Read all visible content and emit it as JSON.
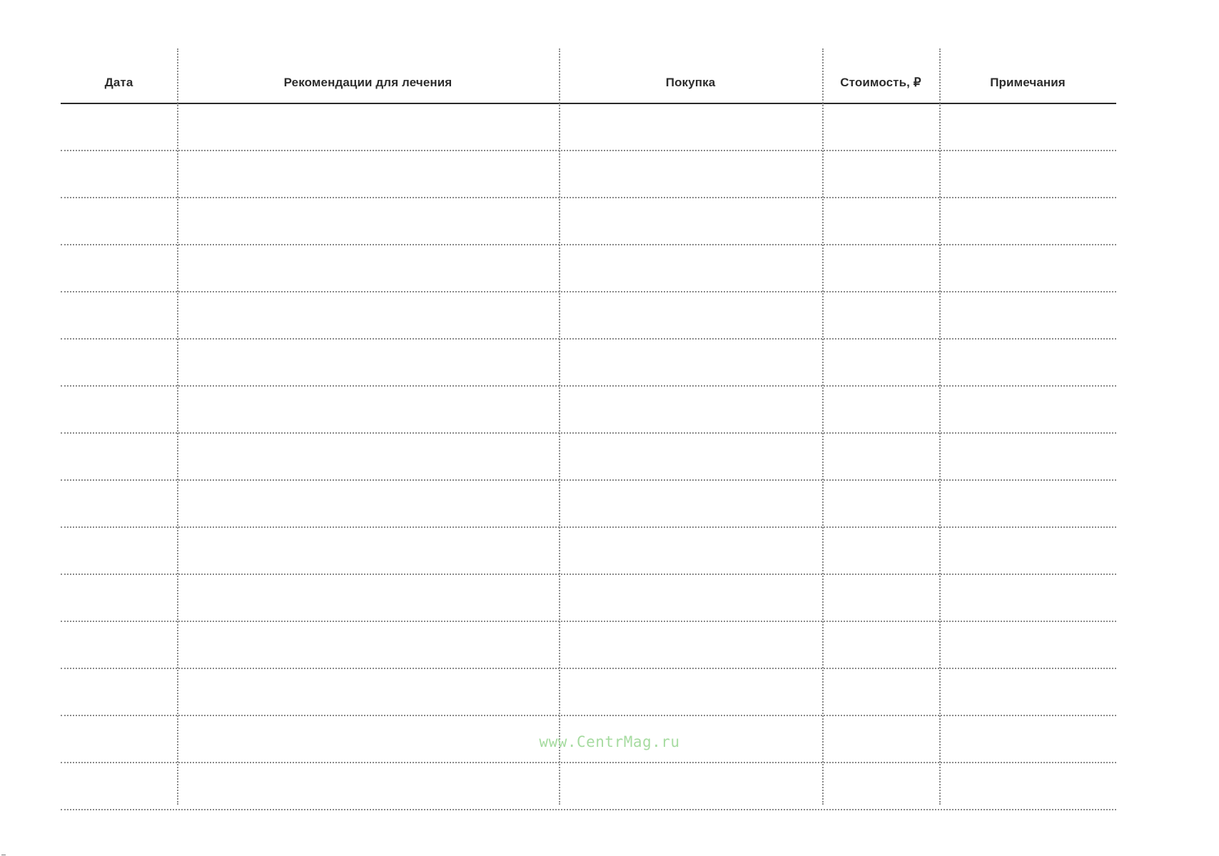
{
  "table": {
    "headers": [
      "Дата",
      "Рекомендации для лечения",
      "Покупка",
      "Стоимость, ₽",
      "Примечания"
    ],
    "row_count": 15
  },
  "watermark": "www.CentrMag.ru"
}
